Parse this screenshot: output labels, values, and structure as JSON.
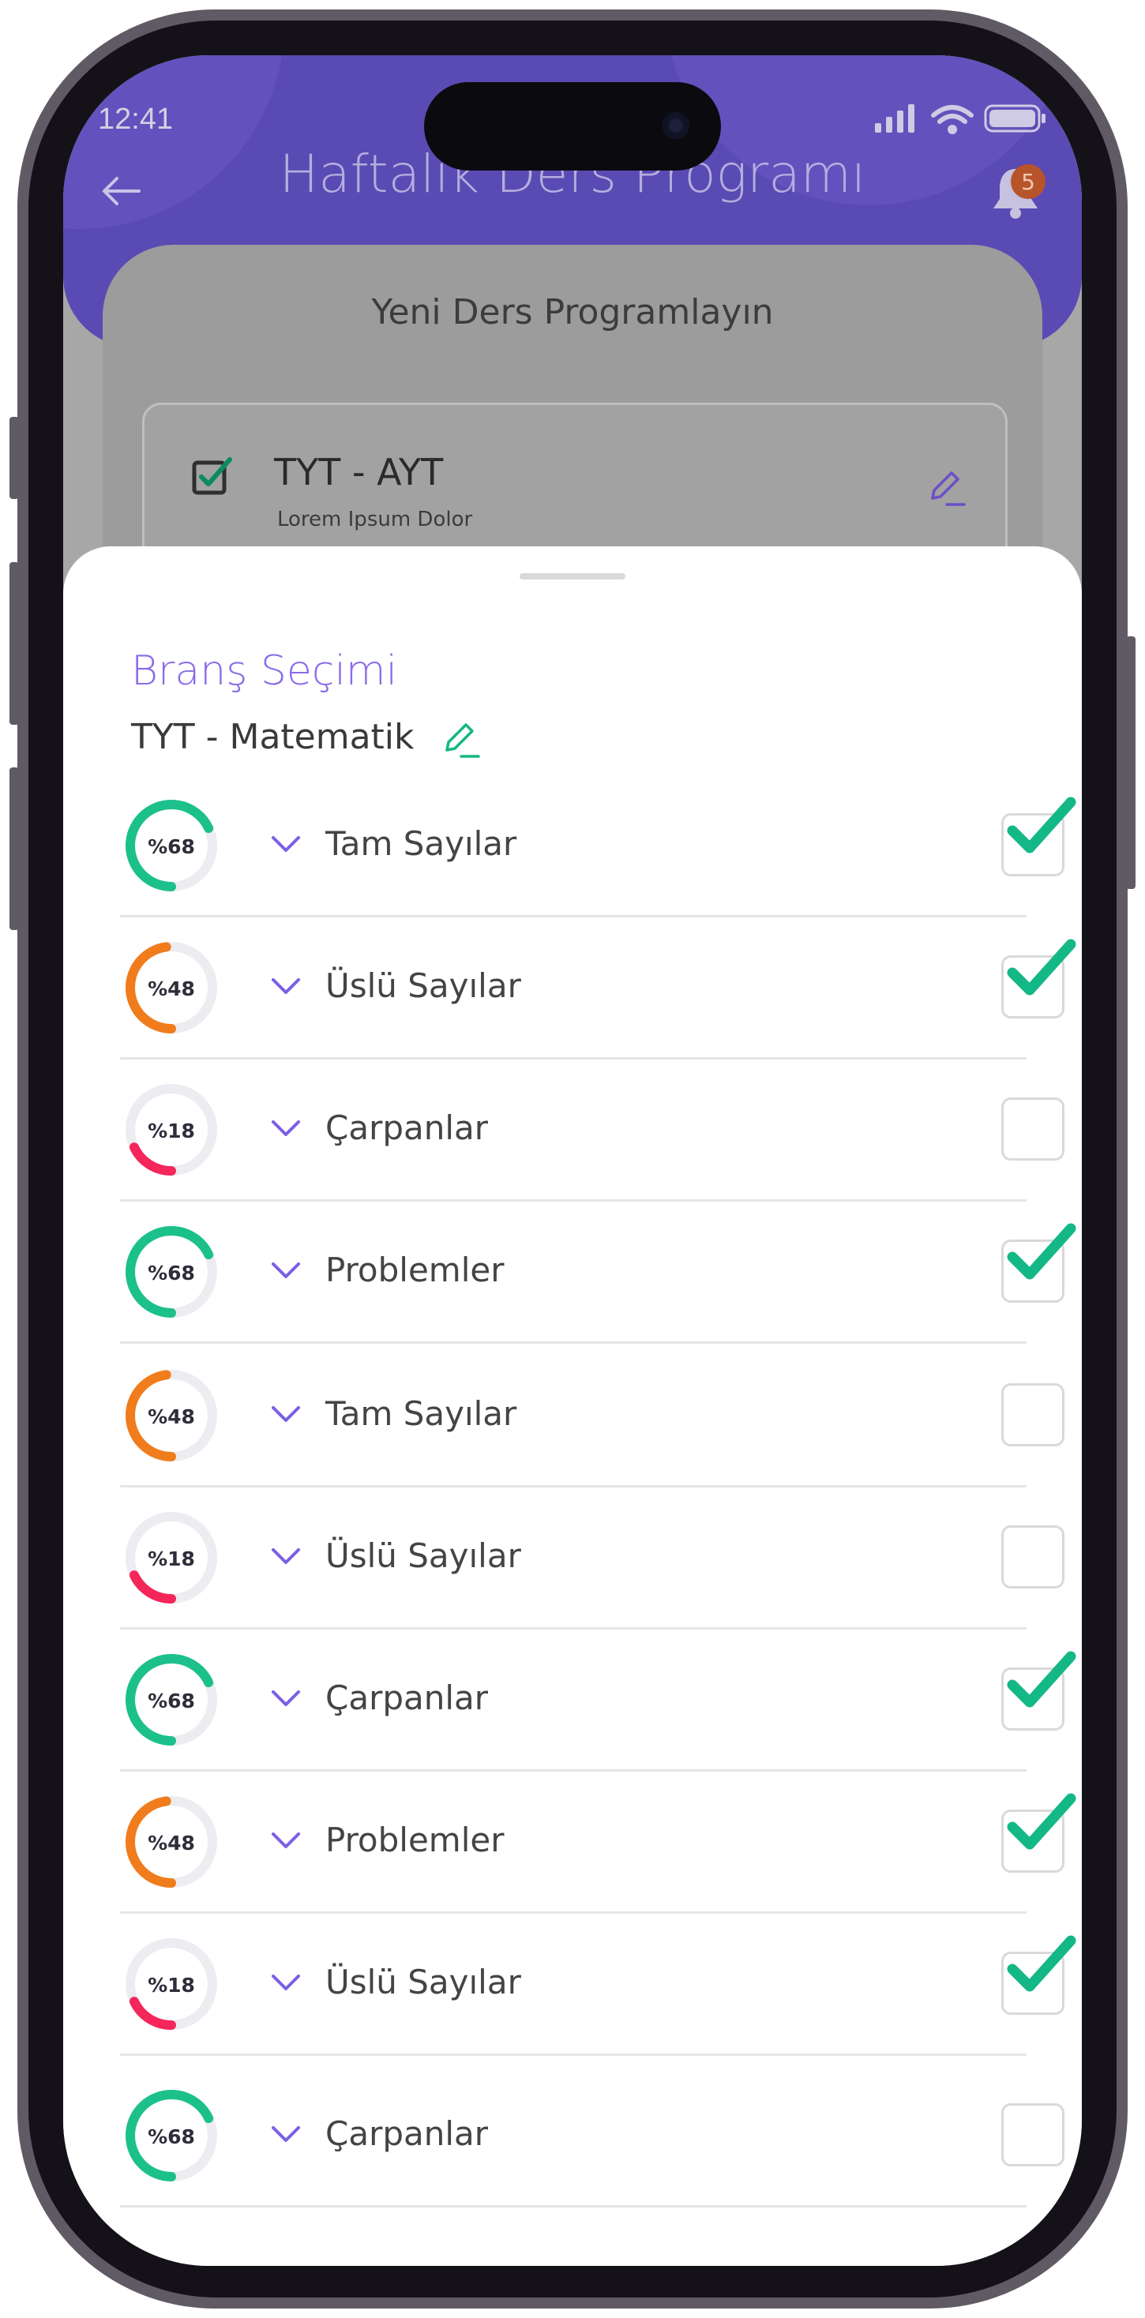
{
  "status_bar": {
    "time": "12:41"
  },
  "header": {
    "title": "Haftalık Ders Programı",
    "badge_count": "5"
  },
  "background_card": {
    "title": "Yeni Ders Programlayın",
    "item_title": "TYT - AYT",
    "item_subtitle": "Lorem Ipsum Dolor"
  },
  "sheet": {
    "title": "Branş Seçimi",
    "subject": "TYT - Matematik",
    "topics": [
      {
        "label": "Tam Sayılar",
        "percent": "%68",
        "progress": 0.68,
        "color": "#1cc08b",
        "checked": true
      },
      {
        "label": "Üslü Sayılar",
        "percent": "%48",
        "progress": 0.48,
        "color": "#f07c1c",
        "checked": true
      },
      {
        "label": "Çarpanlar",
        "percent": "%18",
        "progress": 0.18,
        "color": "#f5265a",
        "checked": false
      },
      {
        "label": "Problemler",
        "percent": "%68",
        "progress": 0.68,
        "color": "#1cc08b",
        "checked": true
      },
      {
        "label": "Tam Sayılar",
        "percent": "%48",
        "progress": 0.48,
        "color": "#f07c1c",
        "checked": false
      },
      {
        "label": "Üslü Sayılar",
        "percent": "%18",
        "progress": 0.18,
        "color": "#f5265a",
        "checked": false
      },
      {
        "label": "Çarpanlar",
        "percent": "%68",
        "progress": 0.68,
        "color": "#1cc08b",
        "checked": true
      },
      {
        "label": "Problemler",
        "percent": "%48",
        "progress": 0.48,
        "color": "#f07c1c",
        "checked": true
      },
      {
        "label": "Üslü Sayılar",
        "percent": "%18",
        "progress": 0.18,
        "color": "#f5265a",
        "checked": true
      },
      {
        "label": "Çarpanlar",
        "percent": "%68",
        "progress": 0.68,
        "color": "#1cc08b",
        "checked": false
      }
    ]
  },
  "colors": {
    "accent": "#8a6ae8",
    "header": "#5a4ab3",
    "check": "#14b886"
  }
}
